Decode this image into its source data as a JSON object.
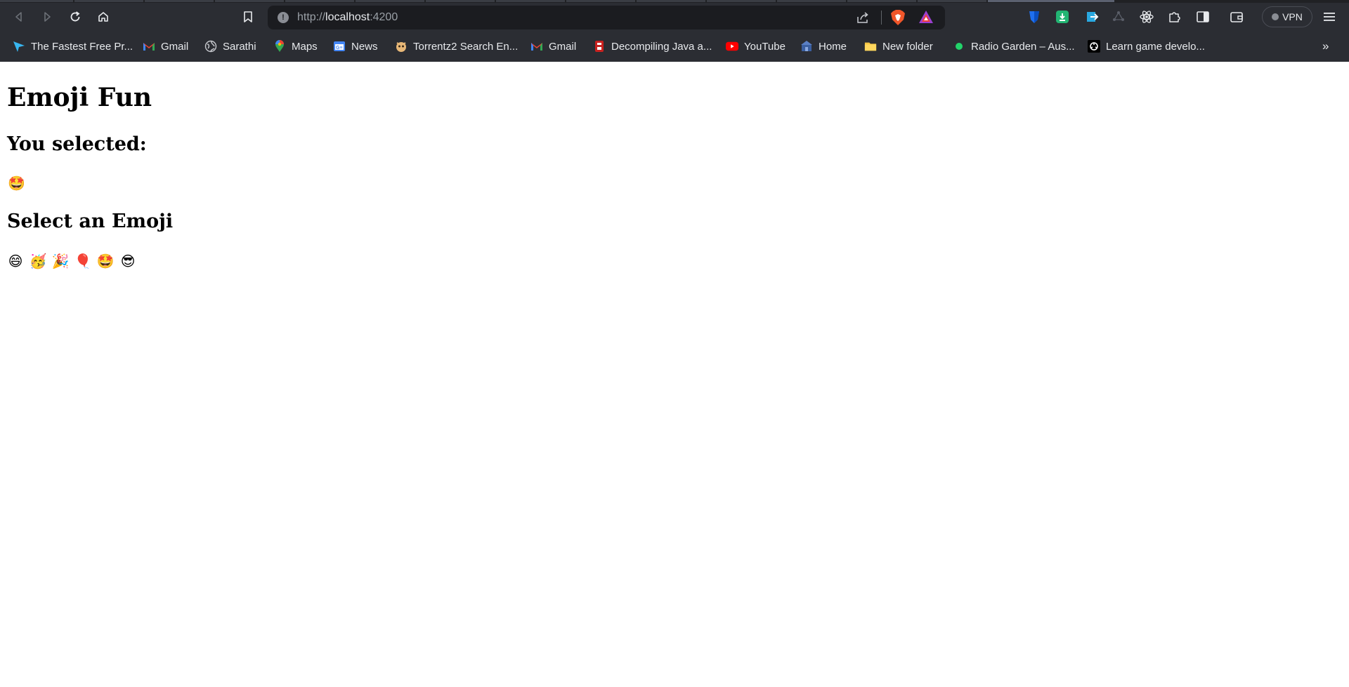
{
  "browser": {
    "url_scheme": "http://",
    "url_host": "localhost",
    "url_port": ":4200",
    "vpn_label": "VPN",
    "bookmarks": [
      {
        "label": "The Fastest Free Pr...",
        "icon": "send-arrow-icon"
      },
      {
        "label": "Gmail",
        "icon": "gmail-icon"
      },
      {
        "label": "Sarathi",
        "icon": "globe-icon"
      },
      {
        "label": "Maps",
        "icon": "maps-pin-icon"
      },
      {
        "label": "News",
        "icon": "news-icon"
      },
      {
        "label": "Torrentz2 Search En...",
        "icon": "torrentz-icon"
      },
      {
        "label": "Gmail",
        "icon": "gmail-icon"
      },
      {
        "label": "Decompiling Java a...",
        "icon": "decompiler-icon"
      },
      {
        "label": "YouTube",
        "icon": "youtube-icon"
      },
      {
        "label": "Home",
        "icon": "home-site-icon"
      },
      {
        "label": "New folder",
        "icon": "folder-icon"
      },
      {
        "label": "Radio Garden – Aus...",
        "icon": "radio-dot-icon"
      },
      {
        "label": "Learn game develo...",
        "icon": "game-dev-icon"
      }
    ],
    "bookmarks_more": "»"
  },
  "page": {
    "title": "Emoji Fun",
    "selected_heading": "You selected:",
    "selected_emoji": "🤩",
    "select_heading": "Select an Emoji",
    "emojis": [
      "😄",
      "🥳",
      "🎉",
      "🎈",
      "🤩",
      "😎"
    ]
  }
}
